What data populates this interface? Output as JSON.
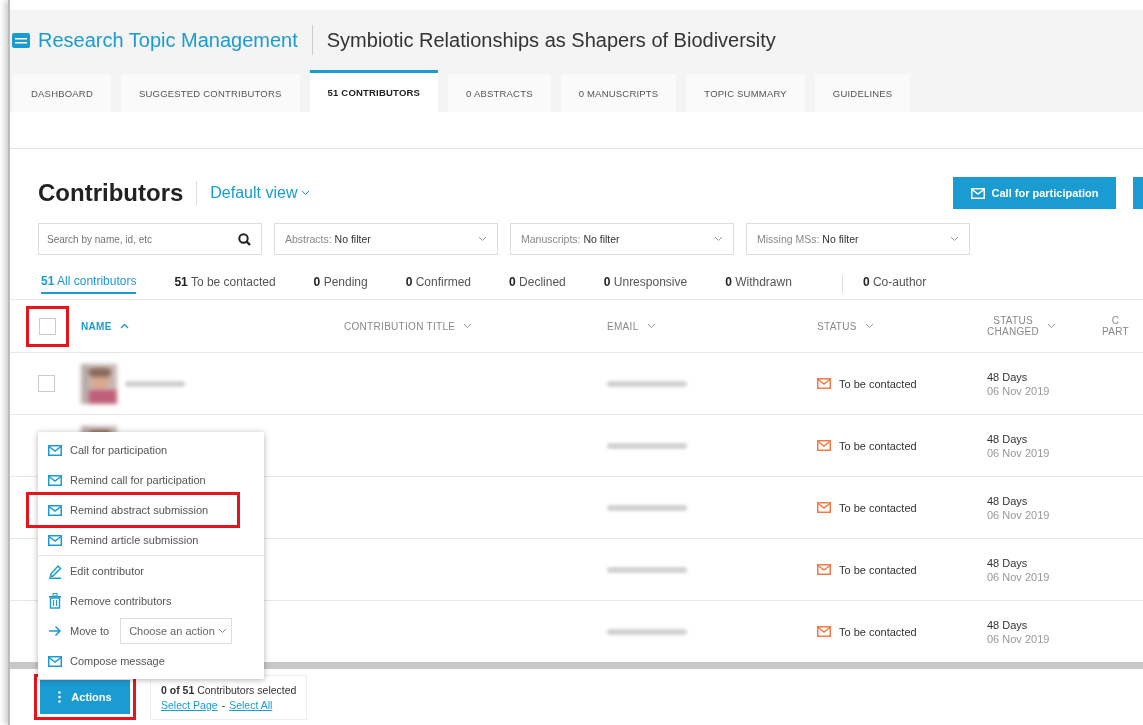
{
  "header": {
    "app_title": "Research Topic Management",
    "page_title": "Symbiotic Relationships as Shapers of Biodiversity"
  },
  "tabs": [
    {
      "label": "DASHBOARD",
      "selected": false
    },
    {
      "label": "SUGGESTED CONTRIBUTORS",
      "selected": false
    },
    {
      "label": "51 CONTRIBUTORS",
      "selected": true
    },
    {
      "label": "0 ABSTRACTS",
      "selected": false
    },
    {
      "label": "0 MANUSCRIPTS",
      "selected": false
    },
    {
      "label": "TOPIC SUMMARY",
      "selected": false
    },
    {
      "label": "GUIDELINES",
      "selected": false
    }
  ],
  "contributors": {
    "title": "Contributors",
    "view_selector": "Default view",
    "primary_button": "Call for participation",
    "search": {
      "placeholder": "Search by name, id, etc"
    },
    "filters": [
      {
        "label": "Abstracts:",
        "value": "No filter"
      },
      {
        "label": "Manuscripts:",
        "value": "No filter"
      },
      {
        "label": "Missing MSs:",
        "value": "No filter"
      }
    ],
    "status_tabs": [
      {
        "text": "**51** All contributors",
        "selected": true
      },
      {
        "text": "**51** To be contacted",
        "selected": false
      },
      {
        "text": "**0** Pending",
        "selected": false
      },
      {
        "text": "**0** Confirmed",
        "selected": false
      },
      {
        "text": "**0** Declined",
        "selected": false
      },
      {
        "text": "**0** Unresponsive",
        "selected": false
      },
      {
        "text": "**0** Withdrawn",
        "selected": false
      },
      {
        "text": "**0** Co-author",
        "selected": false
      }
    ],
    "table": {
      "select_all": {
        "checked": false,
        "highlighted": true
      },
      "columns": [
        {
          "lines": [
            "NAME"
          ],
          "sorted": true
        },
        {
          "lines": [
            "CONTRIBUTION TITLE"
          ],
          "sorted": false
        },
        {
          "lines": [
            "EMAIL"
          ],
          "sorted": false
        },
        {
          "lines": [
            "STATUS"
          ],
          "sorted": false
        },
        {
          "lines": [
            "STATUS",
            "CHANGED"
          ],
          "sorted": false
        },
        {
          "lines": [
            "C",
            "PART"
          ]
        }
      ],
      "rows": [
        {
          "checked": false,
          "status": "To be contacted",
          "days": "48 Days",
          "date": "06 Nov 2019"
        },
        {
          "status": "To be contacted",
          "days": "48 Days",
          "date": "06 Nov 2019"
        },
        {
          "status": "To be contacted",
          "days": "48 Days",
          "date": "06 Nov 2019"
        },
        {
          "status": "To be contacted",
          "days": "48 Days",
          "date": "06 Nov 2019"
        },
        {
          "status": "To be contacted",
          "days": "48 Days",
          "date": "06 Nov 2019"
        }
      ]
    }
  },
  "actions_menu": {
    "items": [
      {
        "kind": "mail",
        "label": "Call for participation",
        "highlighted": false
      },
      {
        "kind": "mail",
        "label": "Remind call for participation",
        "highlighted": false
      },
      {
        "kind": "mail",
        "label": "Remind abstract submission",
        "highlighted": true
      },
      {
        "kind": "mail",
        "label": "Remind article submission",
        "highlighted": false
      },
      {
        "kind": "edit",
        "label": "Edit contributor",
        "highlighted": false
      },
      {
        "kind": "trash",
        "label": "Remove contributors",
        "highlighted": false
      },
      {
        "kind": "move",
        "label": "Move to",
        "select": "Choose an action",
        "highlighted": false
      },
      {
        "kind": "mail",
        "label": "Compose message",
        "highlighted": false
      }
    ]
  },
  "footer": {
    "actions_button": {
      "label": "Actions",
      "highlighted": true
    },
    "summary": "**0 of 51** Contributors selected",
    "links": [
      "Select Page",
      "Select All"
    ],
    "separator": "-"
  }
}
